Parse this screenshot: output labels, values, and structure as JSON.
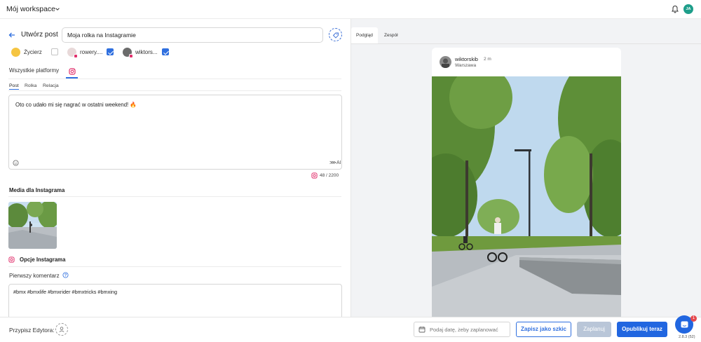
{
  "topbar": {
    "workspace": "Mój workspace",
    "user_initials": "JA"
  },
  "editor_header": {
    "title": "Utwórz post",
    "post_title_value": "Moja rolka na Instagramie"
  },
  "accounts": [
    {
      "name": "Życierz",
      "checked": false
    },
    {
      "name": "rowery....",
      "checked": true
    },
    {
      "name": "wiktors...",
      "checked": true
    }
  ],
  "platform_tabs": {
    "all": "Wszystkie platformy",
    "instagram_icon": "instagram-icon"
  },
  "sub_tabs": [
    "Post",
    "Rolka",
    "Relacja"
  ],
  "caption": {
    "text": "Oto co udało mi się nagrać w ostatni weekend! 🔥",
    "ai_label": "AI",
    "counter": "48 / 2200"
  },
  "media": {
    "title": "Media dla Instagrama"
  },
  "options": {
    "title": "Opcje Instagrama",
    "first_comment_label": "Pierwszy komentarz",
    "first_comment_value": "#bmx #bmxlife #bmxrider #bmxtricks #bmxing"
  },
  "preview": {
    "tabs": [
      "Podgląd",
      "Zespół"
    ],
    "user": "wiktorskib",
    "time": "2 m",
    "location": "Warszawa"
  },
  "bottombar": {
    "assign_label": "Przypisz Edytora:",
    "date_placeholder": "Podaj datę, żeby zaplanować",
    "draft_button": "Zapisz jako szkic",
    "schedule_button": "Zaplanuj",
    "publish_button": "Opublikuj teraz",
    "chat_badge": "1",
    "version": "2.8.3 (52)"
  },
  "colors": {
    "accent": "#2f6fdf",
    "instagram": "#e1306c",
    "avatar": "#1e9e8a"
  }
}
